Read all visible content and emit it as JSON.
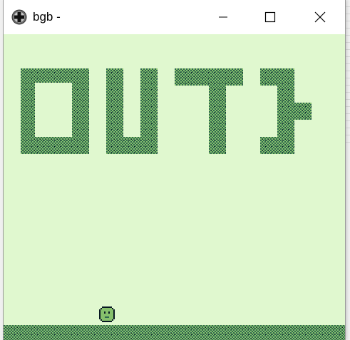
{
  "window": {
    "title": "bgb -",
    "app_icon": "bgb-cross-icon",
    "controls": {
      "minimize_icon": "minimize-icon",
      "maximize_icon": "maximize-icon",
      "close_icon": "close-icon"
    }
  },
  "game": {
    "colors": {
      "background": "#e0f8cf",
      "light_green": "#86c06c",
      "dark_green": "#306850",
      "darkest": "#071821"
    },
    "logo_letters": [
      "O",
      "U",
      "T",
      "}"
    ],
    "player_icon": "round-blob-character-icon"
  }
}
